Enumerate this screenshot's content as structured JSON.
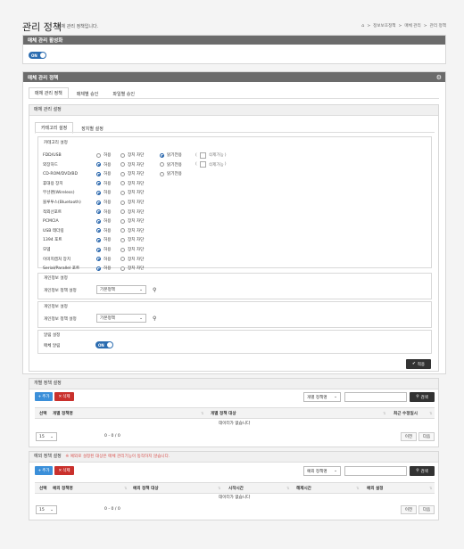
{
  "header": {
    "title": "관리 정책",
    "subtitle": "매체 관리 정책입니다.",
    "breadcrumb": [
      "정보보호정책",
      "매체 관리",
      "관리 정책"
    ],
    "home_icon": "home-icon"
  },
  "activation": {
    "title": "매체 관리 활성화",
    "toggle": "ON"
  },
  "policy": {
    "title": "매체 관리 정책",
    "tabs": [
      "매체 관리 정책",
      "매체별 승인",
      "파일별 승인"
    ],
    "settings_title": "매체 관리 설정",
    "subtabs": [
      "카테고리 설정",
      "장치별 설정"
    ],
    "category_title": "카테고리 설정",
    "options": {
      "allow": "허용",
      "block": "장치 차단",
      "readonly": "읽기전용",
      "delete_paren_open": "(",
      "delete_label": "삭제가능",
      "delete_paren_close": ")"
    },
    "devices": [
      {
        "name": "FDD/USB",
        "selected": "readonly",
        "extra": true
      },
      {
        "name": "외장하드",
        "selected": "allow",
        "extra": true
      },
      {
        "name": "CD-ROM/DVD/BD",
        "selected": "allow",
        "extra": false
      },
      {
        "name": "휴대용 장치",
        "selected": "allow",
        "extra": false
      },
      {
        "name": "무선랜(Wireless)",
        "selected": "allow",
        "extra": false
      },
      {
        "name": "블루투스(Bluetooth)",
        "selected": "allow",
        "extra": false
      },
      {
        "name": "적외선포트",
        "selected": "allow",
        "extra": false
      },
      {
        "name": "PCMCIA",
        "selected": "allow",
        "extra": false
      },
      {
        "name": "USB 테더링",
        "selected": "allow",
        "extra": false
      },
      {
        "name": "1394 포트",
        "selected": "allow",
        "extra": false
      },
      {
        "name": "모뎀",
        "selected": "allow",
        "extra": false
      },
      {
        "name": "이미지캡처 장치",
        "selected": "allow",
        "extra": false
      },
      {
        "name": "Serial/Parallel 포트",
        "selected": "allow",
        "extra": false
      }
    ],
    "privacy1": {
      "title": "개인정보 설정",
      "label": "개인정보 정책 설정",
      "value": "기본정책"
    },
    "privacy2": {
      "title": "개인정보 설정",
      "label": "개인정보 정책 설정",
      "value": "기본정책"
    },
    "alert": {
      "title": "알림 설정",
      "label": "매체 알림",
      "toggle": "ON"
    },
    "apply_label": "적용"
  },
  "individual": {
    "title": "개별 정책 설정",
    "add": "추가",
    "delete": "삭제",
    "filter": "개별 정책명",
    "search": "검색",
    "columns": [
      "선택",
      "개별 정책명",
      "개별 정책 대상",
      "최근 수정일시"
    ],
    "empty": "데이터가 없습니다",
    "page_size": "15",
    "range": "0 - 0 / 0",
    "prev": "이전",
    "next": "다음"
  },
  "exception": {
    "title": "예외 정책 설정",
    "warning": "※ 예외로 설정된 대상은 매체 관리기능이 동작하지 않습니다.",
    "add": "추가",
    "delete": "삭제",
    "filter": "예외 정책명",
    "search": "검색",
    "columns": [
      "선택",
      "예외 정책명",
      "예외 정책 대상",
      "시작시간",
      "해제시간",
      "예외 설정"
    ],
    "empty": "데이터가 없습니다",
    "page_size": "15",
    "range": "0 - 0 / 0",
    "prev": "이전",
    "next": "다음"
  },
  "colors": {
    "accent": "#1f5fa8",
    "header": "#6b6b6b",
    "danger": "#c9302c",
    "dark": "#333333"
  }
}
